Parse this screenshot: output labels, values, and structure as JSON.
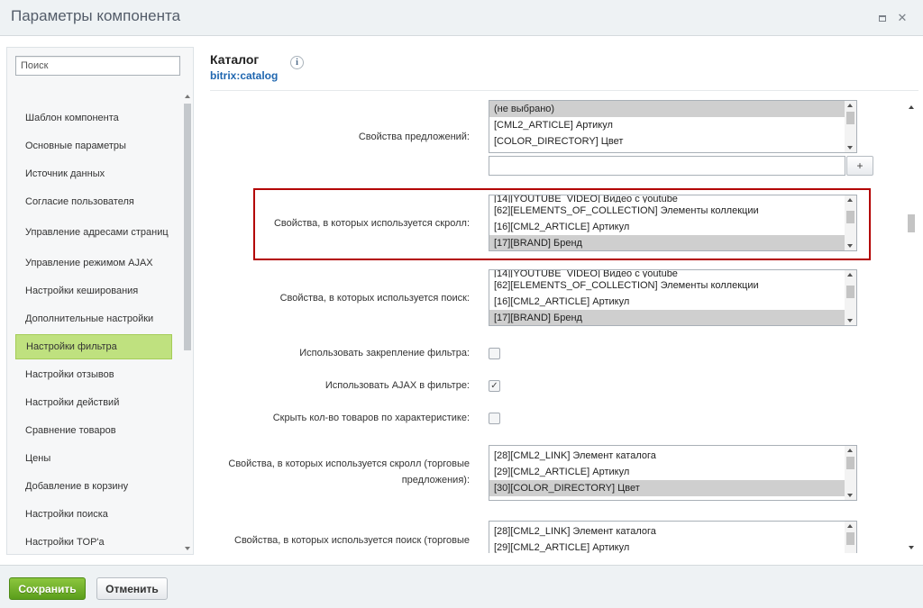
{
  "window": {
    "title": "Параметры компонента",
    "maximize_icon": "maximize-icon",
    "close_icon": "close-icon",
    "close_glyph": "✕"
  },
  "sidebar": {
    "search_placeholder": "Поиск",
    "active_color": "#bfe17f",
    "items": [
      {
        "label": "Шаблон компонента"
      },
      {
        "label": "Основные параметры"
      },
      {
        "label": "Источник данных"
      },
      {
        "label": "Согласие пользователя"
      },
      {
        "label": "Управление адресами страниц"
      },
      {
        "label": "Управление режимом AJAX"
      },
      {
        "label": "Настройки кеширования"
      },
      {
        "label": "Дополнительные настройки"
      },
      {
        "label": "Настройки фильтра",
        "active": true
      },
      {
        "label": "Настройки отзывов"
      },
      {
        "label": "Настройки действий"
      },
      {
        "label": "Сравнение товаров"
      },
      {
        "label": "Цены"
      },
      {
        "label": "Добавление в корзину"
      },
      {
        "label": "Настройки поиска"
      },
      {
        "label": "Настройки TOP'а"
      }
    ]
  },
  "component": {
    "title": "Каталог",
    "code": "bitrix:catalog",
    "info_icon": "info-icon",
    "info_glyph": "i"
  },
  "form": {
    "offer_props": {
      "label": "Свойства предложений:",
      "options": [
        "(не выбрано)",
        "[CML2_ARTICLE] Артикул",
        "[COLOR_DIRECTORY] Цвет"
      ],
      "selected_index": 0,
      "add_label": "+"
    },
    "scroll_props": {
      "label": "Свойства, в которых используется скролл:",
      "partial_top": "[14][YOUTUBE_VIDEO] Видео с youtube",
      "options": [
        "[62][ELEMENTS_OF_COLLECTION] Элементы коллекции",
        "[16][CML2_ARTICLE] Артикул",
        "[17][BRAND] Бренд"
      ],
      "selected_index": 2
    },
    "search_props": {
      "label": "Свойства, в которых используется поиск:",
      "partial_top": "[14][YOUTUBE_VIDEO] Видео с youtube",
      "options": [
        "[62][ELEMENTS_OF_COLLECTION] Элементы коллекции",
        "[16][CML2_ARTICLE] Артикул",
        "[17][BRAND] Бренд"
      ],
      "selected_index": 2
    },
    "filter_pin": {
      "label": "Использовать закрепление фильтра:",
      "checked": false
    },
    "ajax_filter": {
      "label": "Использовать AJAX в фильтре:",
      "checked": true,
      "check_glyph": "✓"
    },
    "hide_count": {
      "label": "Скрыть кол-во товаров по характеристике:",
      "checked": false
    },
    "offer_scroll_props": {
      "label_line1": "Свойства, в которых используется скролл (торговые",
      "label_line2": "предложения):",
      "options": [
        "[28][CML2_LINK] Элемент каталога",
        "[29][CML2_ARTICLE] Артикул",
        "[30][COLOR_DIRECTORY] Цвет"
      ],
      "selected_index": 2
    },
    "offer_search_props": {
      "label_line1": "Свойства, в которых используется поиск (торговые",
      "options": [
        "[28][CML2_LINK] Элемент каталога",
        "[29][CML2_ARTICLE] Артикул"
      ]
    }
  },
  "highlight_color": "#b30000",
  "footer": {
    "save_label": "Сохранить",
    "cancel_label": "Отменить",
    "save_color": "#6aad25"
  }
}
